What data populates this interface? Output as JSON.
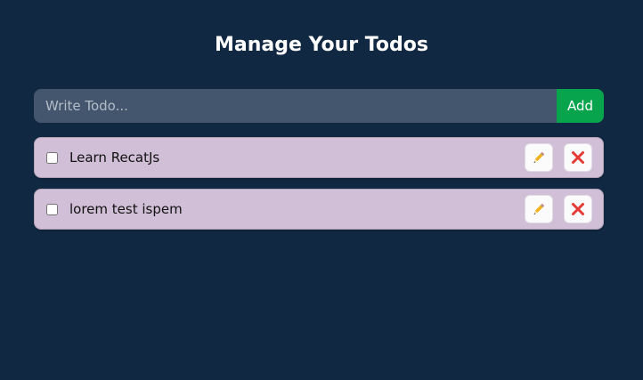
{
  "title": "Manage Your Todos",
  "form": {
    "placeholder": "Write Todo...",
    "value": "",
    "add_label": "Add"
  },
  "todos": [
    {
      "text": "Learn RecatJs",
      "completed": false,
      "edit_icon": "pencil-icon",
      "delete_icon": "cross-mark-icon"
    },
    {
      "text": "lorem test ispem",
      "completed": false,
      "edit_icon": "pencil-icon",
      "delete_icon": "cross-mark-icon"
    }
  ],
  "colors": {
    "background": "#112843",
    "input_background": "#44566d",
    "add_button": "#08a34d",
    "todo_background": "#d0bfd6",
    "delete_icon": "#e53935"
  }
}
